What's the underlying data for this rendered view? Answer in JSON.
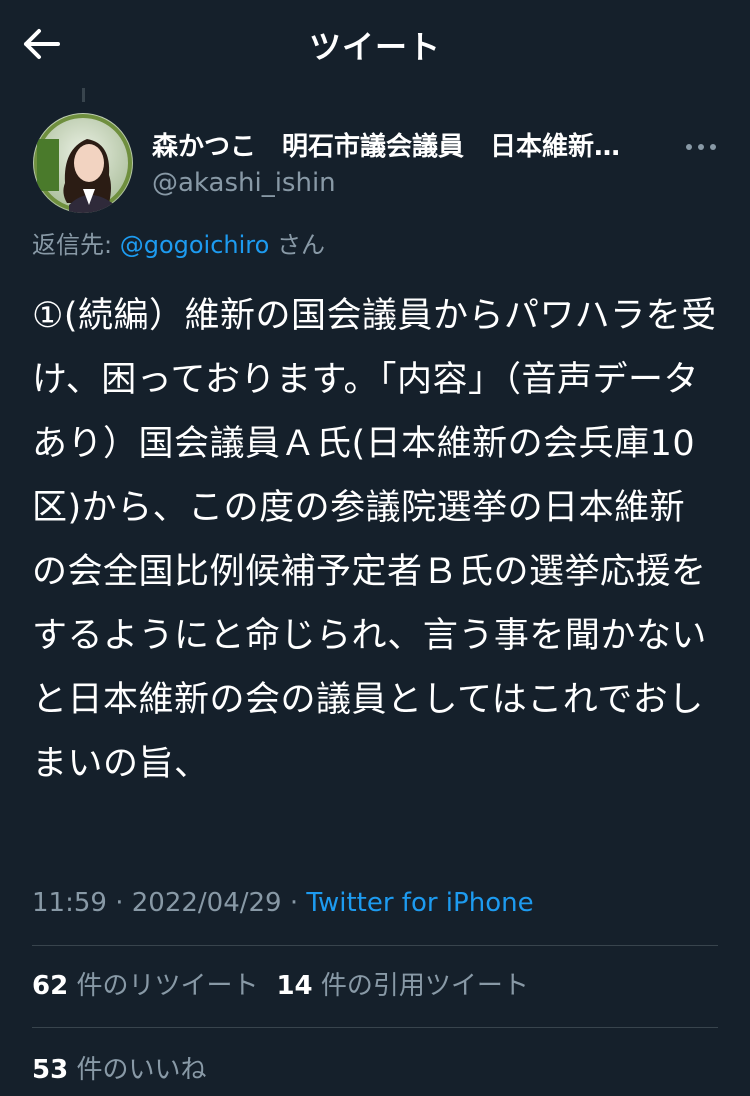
{
  "header": {
    "title": "ツイート",
    "back_icon": "arrow-left-icon"
  },
  "author": {
    "display_name": "森かつこ　明石市議会議員　日本維新…",
    "handle": "@akashi_ishin",
    "more_icon": "more-horizontal-icon"
  },
  "reply": {
    "prefix": "返信先: ",
    "mention": "@gogoichiro",
    "suffix": " さん"
  },
  "tweet": {
    "text": "①(続編）維新の国会議員からパワハラを受け、困っております。「内容」（音声データあり）国会議員Ａ氏(日本維新の会兵庫10区)から、この度の参議院選挙の日本維新の会全国比例候補予定者Ｂ氏の選挙応援をするようにと命じられ、言う事を聞かないと日本維新の会の議員としてはこれでおしまいの旨、"
  },
  "meta": {
    "time": "11:59",
    "separator": " · ",
    "date": "2022/04/29",
    "source": "Twitter for iPhone"
  },
  "stats": {
    "retweets_count": "62",
    "retweets_label": " 件のリツイート",
    "quotes_count": "14",
    "quotes_label": " 件の引用ツイート",
    "likes_count": "53",
    "likes_label": " 件のいいね"
  },
  "colors": {
    "background": "#15202b",
    "text_primary": "#ffffff",
    "text_secondary": "#8899a6",
    "accent": "#1d9bf0",
    "divider": "#38444d"
  }
}
